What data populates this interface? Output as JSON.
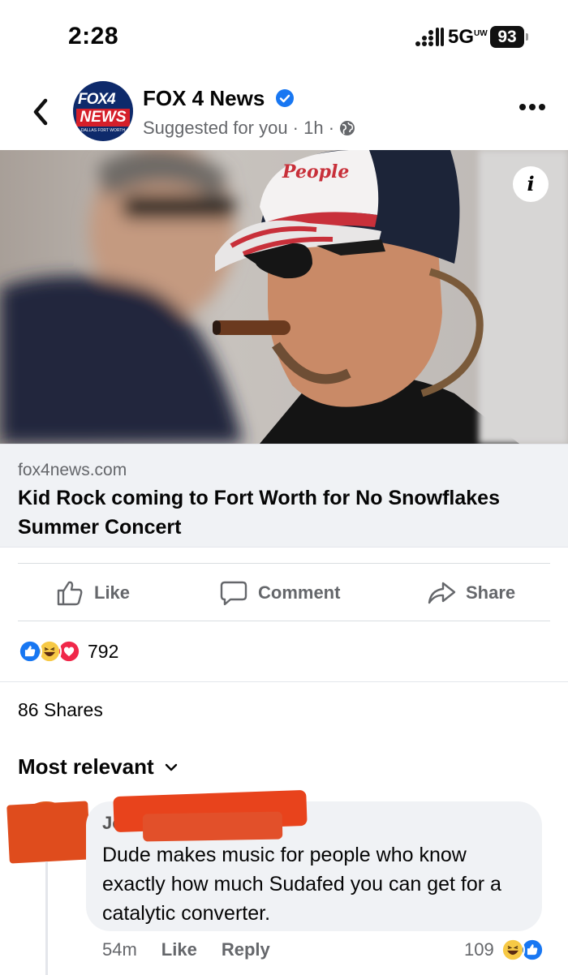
{
  "status_bar": {
    "time": "2:28",
    "network": "5G",
    "network_suffix": "UW",
    "battery": "93"
  },
  "post": {
    "page_name": "FOX 4 News",
    "meta": "Suggested for you · 1h ·",
    "logo": {
      "line1": "FOX4",
      "line2": "NEWS",
      "line3": "DALLAS FORT WORTH"
    },
    "photo_hat_text": "People",
    "link_domain": "fox4news.com",
    "link_title": "Kid Rock coming to Fort Worth for No Snowflakes Summer Concert"
  },
  "actions": {
    "like": "Like",
    "comment": "Comment",
    "share": "Share"
  },
  "engagement": {
    "reaction_count": "792",
    "shares": "86 Shares"
  },
  "comments_sort": {
    "label": "Most relevant"
  },
  "comment": {
    "author_visible": "Jos",
    "text": "Dude makes music for people who know exactly how much Sudafed you can get for a catalytic converter.",
    "time": "54m",
    "like": "Like",
    "reply": "Reply",
    "reaction_count": "109"
  },
  "colors": {
    "accent": "#1877f2",
    "secondary_text": "#65676b",
    "bubble": "#f0f2f5",
    "redaction": "#e24a1f"
  },
  "icons": [
    "back-chevron-icon",
    "verified-badge-icon",
    "globe-icon",
    "more-options-icon",
    "info-icon",
    "thumbs-up-icon",
    "comment-icon",
    "share-arrow-icon",
    "chevron-down-icon"
  ]
}
